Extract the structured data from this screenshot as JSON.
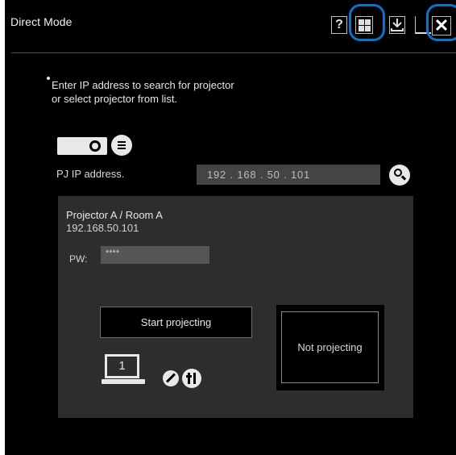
{
  "window": {
    "title": "Direct Mode",
    "toolbar": {
      "help_label": "?",
      "close_label": "✕",
      "highlight_color": "#0b73c9",
      "icons": [
        "help-icon",
        "grid-view-icon",
        "download-icon",
        "minimize-icon",
        "close-icon"
      ]
    }
  },
  "instruction": {
    "text": "Enter IP address to search for projector\nor select projector from list."
  },
  "ip": {
    "label": "PJ IP address.",
    "value": "192 . 168 . 50 . 101"
  },
  "projector": {
    "name": "Projector A / Room A",
    "address": "192.168.50.101",
    "pw_label": "PW:",
    "pw_value": "****",
    "start_button": "Start projecting",
    "status": "Not projecting",
    "screen_number": "1"
  },
  "colors": {
    "background": "#000000",
    "panel": "#2d2d2d",
    "field": "#444444",
    "accent": "#0b73c9"
  }
}
